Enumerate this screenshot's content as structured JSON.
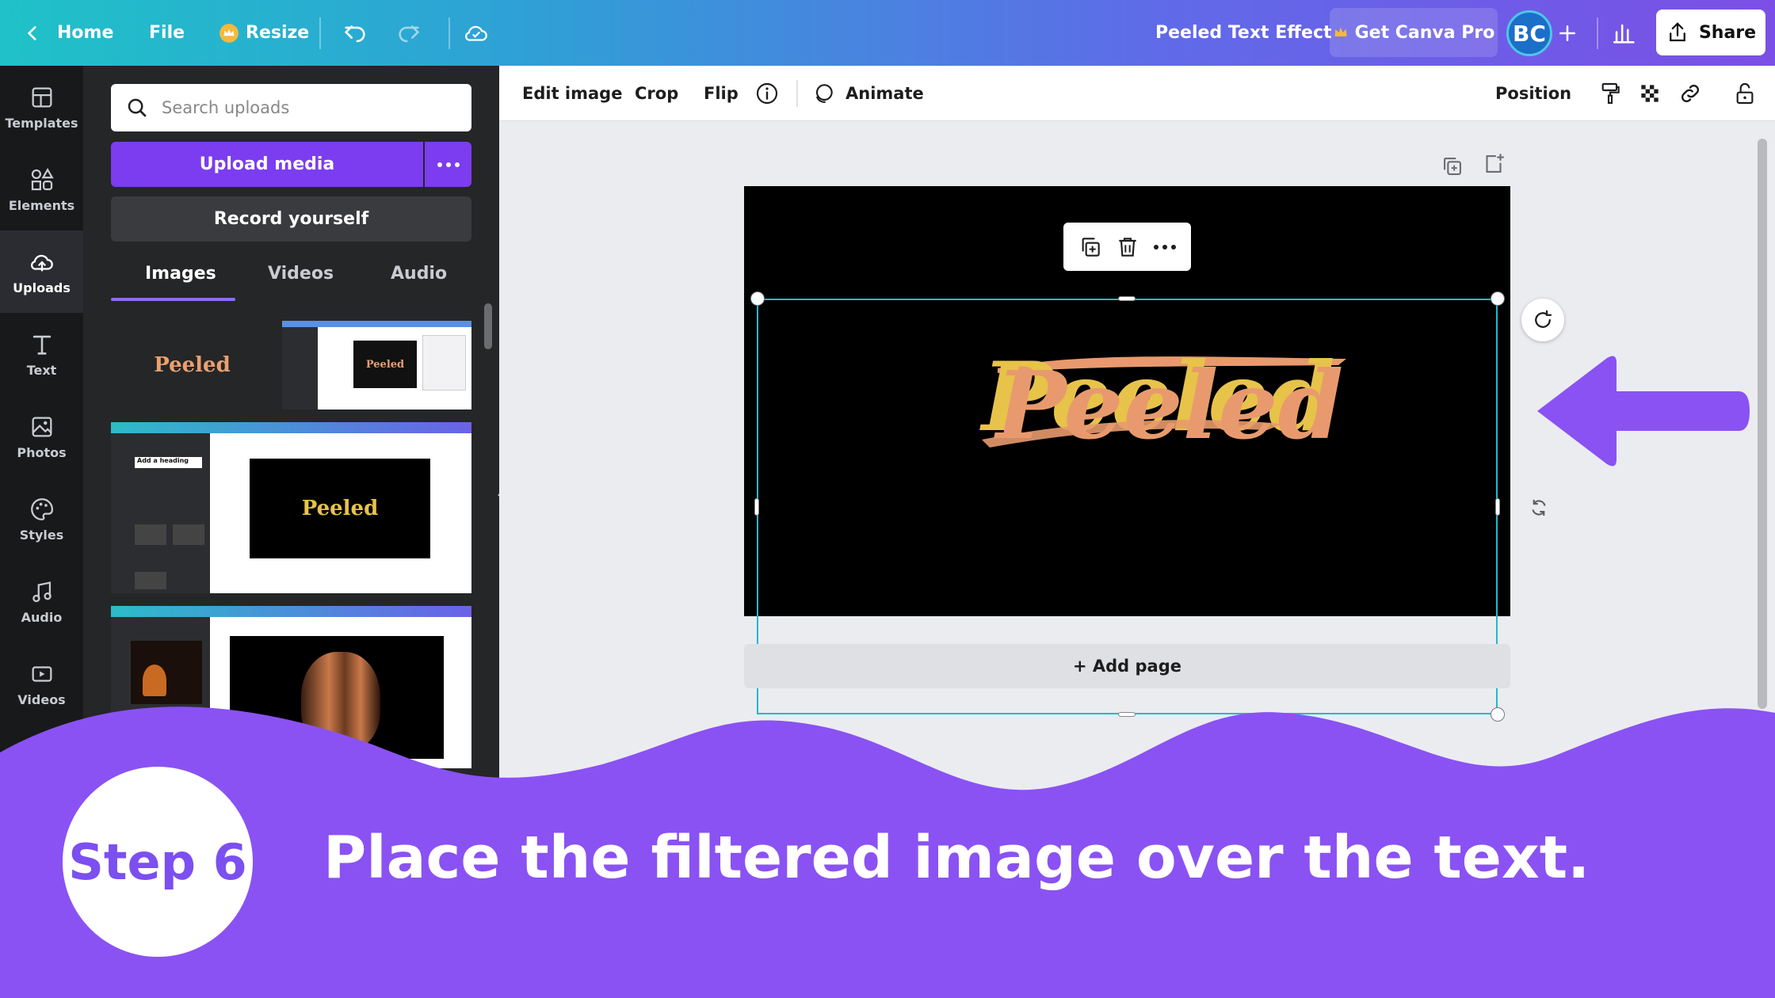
{
  "topbar": {
    "home": "Home",
    "file": "File",
    "resize": "Resize",
    "doc_title": "Peeled Text Effect",
    "get_pro": "Get Canva Pro",
    "avatar": "BC",
    "share": "Share"
  },
  "sidebar": {
    "items": [
      {
        "label": "Templates",
        "icon": "templates-icon"
      },
      {
        "label": "Elements",
        "icon": "elements-icon"
      },
      {
        "label": "Uploads",
        "icon": "uploads-icon"
      },
      {
        "label": "Text",
        "icon": "text-icon"
      },
      {
        "label": "Photos",
        "icon": "photos-icon"
      },
      {
        "label": "Styles",
        "icon": "styles-icon"
      },
      {
        "label": "Audio",
        "icon": "audio-icon"
      },
      {
        "label": "Videos",
        "icon": "videos-icon"
      }
    ]
  },
  "uploads": {
    "search_placeholder": "Search uploads",
    "upload_media": "Upload media",
    "record_yourself": "Record yourself",
    "tabs": [
      "Images",
      "Videos",
      "Audio"
    ],
    "thumb_text": "Peeled"
  },
  "toolbar": {
    "edit_image": "Edit image",
    "crop": "Crop",
    "flip": "Flip",
    "animate": "Animate",
    "position": "Position"
  },
  "canvas": {
    "artwork_text": "Peeled",
    "add_page": "+ Add page"
  },
  "overlay": {
    "step": "Step 6",
    "caption": "Place the filtered image over the text."
  },
  "colors": {
    "accent_purple": "#7c3cf0",
    "overlay_purple": "#8a52f3",
    "selection_cyan": "#1fb9d0",
    "peel_gold": "#e7c34a",
    "peel_salmon": "#e89a6e"
  }
}
